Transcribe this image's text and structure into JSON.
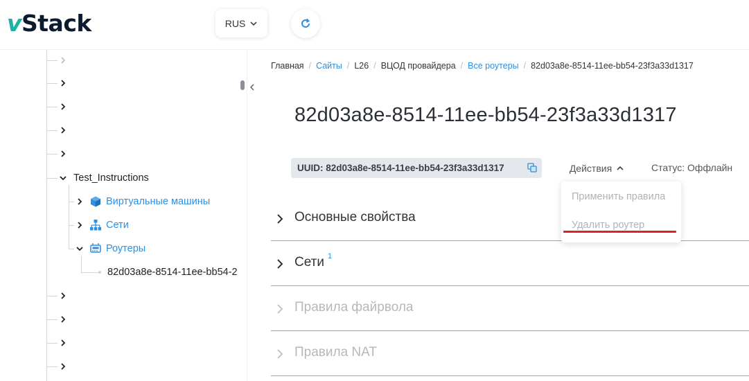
{
  "header": {
    "logo_v": "v",
    "logo_rest": "Stack",
    "language": "RUS",
    "icons": {
      "language_chevron": "chevron-down-icon",
      "refresh": "refresh-icon"
    }
  },
  "sidebar": {
    "folder_node_label": "Test_Instructions",
    "children": [
      {
        "label": "Виртуальные машины",
        "icon": "cube-icon"
      },
      {
        "label": "Сети",
        "icon": "network-icon"
      },
      {
        "label": "Роутеры",
        "icon": "router-icon"
      }
    ],
    "router_leaf_label": "82d03a8e-8514-11ee-bb54-2",
    "colors": {
      "link": "#2d8fe0",
      "icon_blue": "#2d8fe0",
      "tree_line": "#cfd4da"
    }
  },
  "breadcrumb": [
    {
      "label": "Главная",
      "link": false
    },
    {
      "label": "Сайты",
      "link": true
    },
    {
      "label": "L26",
      "link": false
    },
    {
      "label": "ВЦОД провайдера",
      "link": false
    },
    {
      "label": "Все роутеры",
      "link": true
    },
    {
      "label": "82d03a8e-8514-11ee-bb54-23f3a33d1317",
      "link": false
    }
  ],
  "page": {
    "title": "82d03a8e-8514-11ee-bb54-23f3a33d1317",
    "uuid_label": "UUID: 82d03a8e-8514-11ee-bb54-23f3a33d1317",
    "actions_label": "Действия",
    "status_label": "Статус: Оффлайн"
  },
  "actions_menu": {
    "items": [
      {
        "label": "Применить правила"
      },
      {
        "label": "Удалить роутер"
      }
    ],
    "highlight_color": "#e0202a"
  },
  "sections": [
    {
      "title": "Основные свойства",
      "count": "",
      "enabled": true
    },
    {
      "title": "Сети",
      "count": "1",
      "enabled": true
    },
    {
      "title": "Правила файрвола",
      "count": "",
      "enabled": false
    },
    {
      "title": "Правила NAT",
      "count": "",
      "enabled": false
    }
  ]
}
